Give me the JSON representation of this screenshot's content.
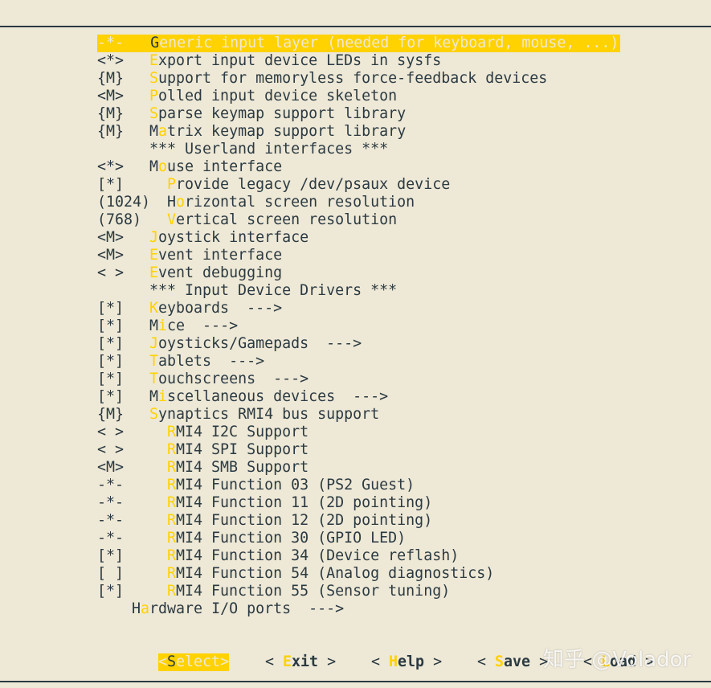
{
  "colors": {
    "background": "#eee8d6",
    "text": "#2b3a42",
    "highlight": "#ffd200"
  },
  "menu": {
    "items": [
      {
        "status": "-*-",
        "hotkey": "G",
        "rest": "eneric input layer (needed for keyboard, mouse, ...)",
        "indent": "  ",
        "selected": true
      },
      {
        "status": "<*>",
        "hotkey": "E",
        "rest": "xport input device LEDs in sysfs",
        "indent": "",
        "selected": false
      },
      {
        "status": "{M}",
        "hotkey": "S",
        "rest": "upport for memoryless force-feedback devices",
        "indent": "",
        "selected": false
      },
      {
        "status": "<M>",
        "hotkey": "P",
        "rest": "olled input device skeleton",
        "indent": "",
        "selected": false
      },
      {
        "status": "{M}",
        "hotkey": "S",
        "rest": "parse keymap support library",
        "indent": "",
        "selected": false
      },
      {
        "status": "{M}",
        "prefix": "M",
        "hotkey": "a",
        "rest": "trix keymap support library",
        "indent": "",
        "selected": false
      },
      {
        "status": "",
        "prefix": "*** Userland interfaces ***",
        "hotkey": "",
        "rest": "",
        "indent": "",
        "selected": false
      },
      {
        "status": "<*>",
        "prefix": "M",
        "hotkey": "o",
        "rest": "use interface",
        "indent": "",
        "selected": false
      },
      {
        "status": "[*]",
        "hotkey": "P",
        "rest": "rovide legacy /dev/psaux device",
        "indent": "  ",
        "selected": false
      },
      {
        "status": "(1024)",
        "prefix": "H",
        "hotkey": "o",
        "rest": "rizontal screen resolution",
        "indent": "  ",
        "selected": false
      },
      {
        "status": "(768)",
        "hotkey": "V",
        "rest": "ertical screen resolution",
        "indent": "  ",
        "selected": false
      },
      {
        "status": "<M>",
        "hotkey": "J",
        "rest": "oystick interface",
        "indent": "",
        "selected": false
      },
      {
        "status": "<M>",
        "hotkey": "E",
        "rest": "vent interface",
        "indent": "",
        "selected": false
      },
      {
        "status": "< >",
        "hotkey": "E",
        "rest": "vent debugging",
        "indent": "",
        "selected": false
      },
      {
        "status": "",
        "prefix": "*** Input Device Drivers ***",
        "hotkey": "",
        "rest": "",
        "indent": "",
        "selected": false
      },
      {
        "status": "[*]",
        "hotkey": "K",
        "rest": "eyboards  --->",
        "indent": "",
        "selected": false
      },
      {
        "status": "[*]",
        "prefix": "M",
        "hotkey": "i",
        "rest": "ce  --->",
        "indent": "",
        "selected": false
      },
      {
        "status": "[*]",
        "hotkey": "J",
        "rest": "oysticks/Gamepads  --->",
        "indent": "",
        "selected": false
      },
      {
        "status": "[*]",
        "hotkey": "T",
        "rest": "ablets  --->",
        "indent": "",
        "selected": false
      },
      {
        "status": "[*]",
        "hotkey": "T",
        "rest": "ouchscreens  --->",
        "indent": "",
        "selected": false
      },
      {
        "status": "[*]",
        "prefix": "M",
        "hotkey": "i",
        "rest": "scellaneous devices  --->",
        "indent": "",
        "selected": false
      },
      {
        "status": "{M}",
        "hotkey": "S",
        "rest": "ynaptics RMI4 bus support",
        "indent": "",
        "selected": false
      },
      {
        "status": "< >",
        "hotkey": "R",
        "rest": "MI4 I2C Support",
        "indent": "  ",
        "selected": false
      },
      {
        "status": "< >",
        "hotkey": "R",
        "rest": "MI4 SPI Support",
        "indent": "  ",
        "selected": false
      },
      {
        "status": "<M>",
        "hotkey": "R",
        "rest": "MI4 SMB Support",
        "indent": "  ",
        "selected": false
      },
      {
        "status": "-*-",
        "hotkey": "R",
        "rest": "MI4 Function 03 (PS2 Guest)",
        "indent": "  ",
        "selected": false
      },
      {
        "status": "-*-",
        "hotkey": "R",
        "rest": "MI4 Function 11 (2D pointing)",
        "indent": "  ",
        "selected": false
      },
      {
        "status": "-*-",
        "hotkey": "R",
        "rest": "MI4 Function 12 (2D pointing)",
        "indent": "  ",
        "selected": false
      },
      {
        "status": "-*-",
        "hotkey": "R",
        "rest": "MI4 Function 30 (GPIO LED)",
        "indent": "  ",
        "selected": false
      },
      {
        "status": "[*]",
        "hotkey": "R",
        "rest": "MI4 Function 34 (Device reflash)",
        "indent": "  ",
        "selected": false
      },
      {
        "status": "[ ]",
        "hotkey": "R",
        "rest": "MI4 Function 54 (Analog diagnostics)",
        "indent": "  ",
        "selected": false
      },
      {
        "status": "[*]",
        "hotkey": "R",
        "rest": "MI4 Function 55 (Sensor tuning)",
        "indent": "  ",
        "selected": false
      },
      {
        "status": "",
        "prefix": "H",
        "hotkey": "a",
        "rest": "rdware I/O ports  --->",
        "indent": "",
        "selected": false,
        "outdent": true
      }
    ]
  },
  "buttons": [
    {
      "name": "select-button",
      "open": "<",
      "hotkey": "S",
      "rest": "elect",
      "close": ">",
      "active": true
    },
    {
      "name": "exit-button",
      "open": "< ",
      "hotkey": "E",
      "rest": "xit",
      "close": " >",
      "active": false
    },
    {
      "name": "help-button",
      "open": "< ",
      "hotkey": "H",
      "rest": "elp",
      "close": " >",
      "active": false
    },
    {
      "name": "save-button",
      "open": "< ",
      "hotkey": "S",
      "rest": "ave",
      "close": " >",
      "active": false
    },
    {
      "name": "load-button",
      "open": "< ",
      "hotkey": "L",
      "rest": "oad",
      "close": " >",
      "active": false
    }
  ],
  "watermark": "知乎 @Volador"
}
